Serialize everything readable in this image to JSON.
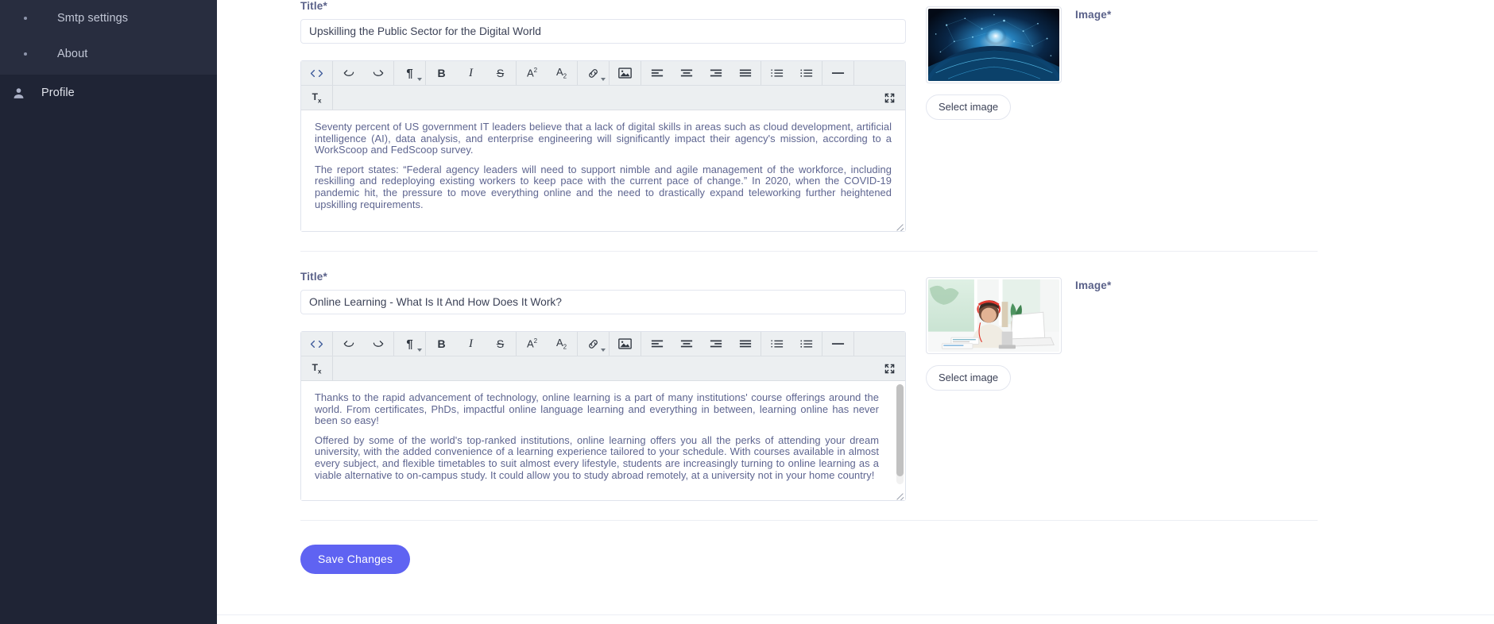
{
  "sidebar": {
    "submenu_items": [
      {
        "label": "Smtp settings",
        "icon": "bullet-dot"
      },
      {
        "label": "About",
        "icon": "bullet-dot"
      }
    ],
    "nav_items": [
      {
        "label": "Profile",
        "icon": "user-icon"
      }
    ],
    "background_color": "#1f2435",
    "submenu_background_color": "#282d3f"
  },
  "toolbar": {
    "groups": [
      {
        "buttons": [
          {
            "name": "source-code",
            "glyph": "<>"
          }
        ]
      },
      {
        "buttons": [
          {
            "name": "undo",
            "glyph": "↰"
          },
          {
            "name": "redo",
            "glyph": "↱"
          }
        ]
      },
      {
        "buttons": [
          {
            "name": "paragraph-format",
            "glyph": "¶",
            "has_caret": true
          }
        ]
      },
      {
        "buttons": [
          {
            "name": "bold",
            "glyph": "B"
          },
          {
            "name": "italic",
            "glyph": "I"
          },
          {
            "name": "strikethrough",
            "glyph": "S"
          }
        ]
      },
      {
        "buttons": [
          {
            "name": "superscript",
            "glyph": "A²"
          },
          {
            "name": "subscript",
            "glyph": "A₂"
          }
        ]
      },
      {
        "buttons": [
          {
            "name": "insert-link",
            "glyph": "link",
            "has_caret": true
          }
        ]
      },
      {
        "buttons": [
          {
            "name": "insert-image",
            "glyph": "image"
          }
        ]
      },
      {
        "buttons": [
          {
            "name": "align-left",
            "glyph": "align-left"
          },
          {
            "name": "align-center",
            "glyph": "align-center"
          },
          {
            "name": "align-right",
            "glyph": "align-right"
          },
          {
            "name": "align-justify",
            "glyph": "align-justify"
          }
        ]
      },
      {
        "buttons": [
          {
            "name": "ordered-list",
            "glyph": "ol"
          },
          {
            "name": "unordered-list",
            "glyph": "ul"
          }
        ]
      },
      {
        "buttons": [
          {
            "name": "horizontal-rule",
            "glyph": "—"
          }
        ]
      }
    ],
    "second_row": [
      {
        "name": "clear-formatting",
        "glyph": "Tx"
      }
    ],
    "expand_button": {
      "name": "fullscreen",
      "glyph": "expand"
    },
    "background_color": "#eceff1"
  },
  "sections": [
    {
      "title_label": "Title*",
      "title_value": "Upskilling the Public Sector for the Digital World",
      "image_label": "Image*",
      "select_image_label": "Select image",
      "image_alt": "digital globe network",
      "paragraphs": [
        "Seventy percent of US government IT leaders believe that a lack of digital skills in areas such as cloud development, artificial intelligence (AI), data analysis, and enterprise engineering will significantly impact their agency's mission, according to a WorkScoop and FedScoop survey.",
        "The report states: “Federal agency leaders will need to support nimble and agile management of the workforce, including reskilling and redeploying existing workers to keep pace with the current pace of change.” In 2020, when the COVID-19 pandemic hit, the pressure to move everything online and the need to drastically expand teleworking further heightened upskilling requirements."
      ],
      "has_scrollbar": false
    },
    {
      "title_label": "Title*",
      "title_value": "Online Learning - What Is It And How Does It Work?",
      "image_label": "Image*",
      "select_image_label": "Select image",
      "image_alt": "woman studying online with laptop",
      "paragraphs": [
        "Thanks to the rapid advancement of technology, online learning is a part of many institutions' course offerings around the world. From certificates, PhDs, impactful online language learning and everything in between, learning online has never been so easy!",
        "Offered by some of the world's top-ranked institutions, online learning offers you all the perks of attending your dream university, with the added convenience of a learning experience tailored to your schedule. With courses available in almost every subject, and flexible timetables to suit almost every lifestyle, students are increasingly turning to online learning as a viable alternative to on-campus study. It could allow you to study abroad remotely, at a university not in your home country!"
      ],
      "has_scrollbar": true
    }
  ],
  "footer": {
    "save_label": "Save Changes",
    "save_color": "#5f63f2"
  }
}
